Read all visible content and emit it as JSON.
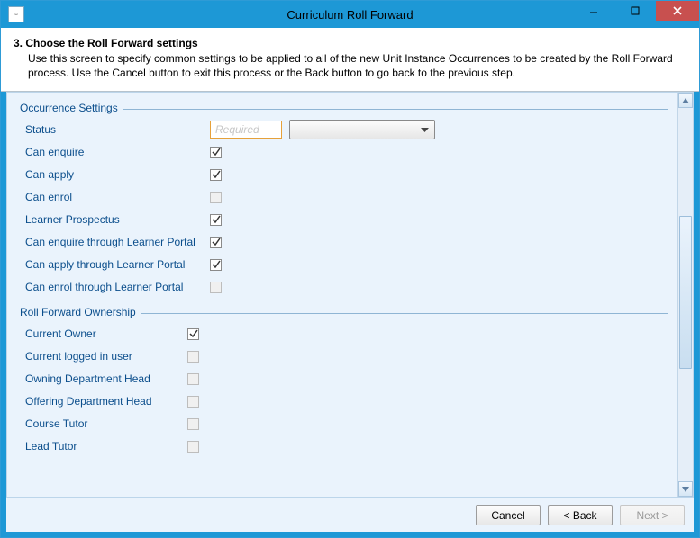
{
  "window": {
    "title": "Curriculum Roll Forward"
  },
  "header": {
    "step_title": "3. Choose the Roll Forward settings",
    "description": "Use this screen to specify common settings to be applied to all of the new Unit Instance Occurrences to be created by the Roll Forward process. Use the Cancel button to exit this process or the Back button to go back to the previous step."
  },
  "groups": {
    "occurrence": {
      "legend": "Occurrence Settings",
      "status_label": "Status",
      "status_placeholder": "Required",
      "items": [
        {
          "label": "Can enquire",
          "checked": true
        },
        {
          "label": "Can apply",
          "checked": true
        },
        {
          "label": "Can enrol",
          "checked": false
        },
        {
          "label": "Learner Prospectus",
          "checked": true
        },
        {
          "label": "Can enquire through Learner Portal",
          "checked": true
        },
        {
          "label": "Can apply through Learner Portal",
          "checked": true
        },
        {
          "label": "Can enrol through Learner Portal",
          "checked": false
        }
      ]
    },
    "ownership": {
      "legend": "Roll Forward Ownership",
      "items": [
        {
          "label": "Current Owner",
          "checked": true
        },
        {
          "label": "Current logged in user",
          "checked": false
        },
        {
          "label": "Owning Department Head",
          "checked": false
        },
        {
          "label": "Offering Department Head",
          "checked": false
        },
        {
          "label": "Course Tutor",
          "checked": false
        },
        {
          "label": "Lead Tutor",
          "checked": false
        }
      ]
    }
  },
  "footer": {
    "cancel": "Cancel",
    "back": "< Back",
    "next": "Next >"
  }
}
